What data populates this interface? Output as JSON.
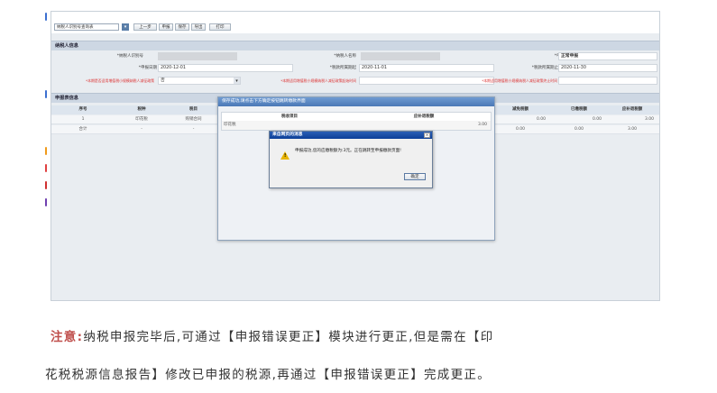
{
  "toolbar": {
    "select_value": "纳税人识别号查询表",
    "dropdown_icon": "chevron-down-icon",
    "buttons": [
      "上一步",
      "申报",
      "保存",
      "导出",
      "打印"
    ]
  },
  "taxpayer": {
    "section_title": "纳税人信息",
    "id_label": "*纳税人识别号",
    "name_label": "*纳税人名称",
    "type_label": "*申报类型",
    "type_value": "正常申报",
    "date_label": "*申报日期",
    "date_value": "2020-12-01",
    "period_start_label": "*税款所属期起",
    "period_start_value": "2020-11-01",
    "period_end_label": "*税款所属期止",
    "period_end_value": "2020-11-30",
    "q1_label": "*本期是否适用增值税小规模纳税人减征政策",
    "q1_value": "否",
    "q2_label": "*本期适用增值税小规模纳税人减征政策起始时间",
    "q3_label": "*本期适用增值税小规模纳税人减征政策终止时间"
  },
  "declaration": {
    "section_title": "申报表信息",
    "headers": [
      "序号",
      "税种",
      "税目",
      "减免税额",
      "已缴税额",
      "应补退税额"
    ],
    "row": [
      "1",
      "印花税",
      "购销合同",
      "0.00",
      "0.00",
      "3.00"
    ],
    "total": [
      "合计",
      "-",
      "-",
      "0.00",
      "0.00",
      "3.00"
    ]
  },
  "dialog_list": {
    "title": "保存成功,请点击下方确定按钮跳转缴款界面",
    "col1": "税收项目",
    "col2": "应补退税额",
    "row_name": "印花税",
    "row_value": "3.00"
  },
  "dialog_msg": {
    "title": "来自网页的消息",
    "close": "×",
    "message": "申报成功,您的应缴税额为:3元。正在跳转至申报缴款页面!",
    "ok": "确定",
    "icon": "warning-icon"
  },
  "note": {
    "label": "注意:",
    "line1": "纳税申报完毕后,可通过【申报错误更正】模块进行更正,但是需在【印",
    "line2": "花税税源信息报告】修改已申报的税源,再通过【申报错误更正】完成更正。"
  },
  "colors": {
    "accent": "#4a78b6",
    "note_label": "#c0504d"
  }
}
